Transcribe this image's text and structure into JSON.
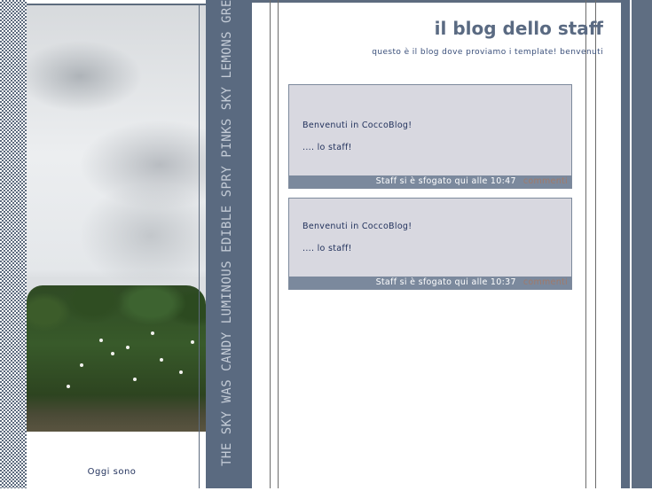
{
  "blog": {
    "title": "il blog dello staff",
    "subtitle": "questo è il blog dove proviamo i template! benvenuti"
  },
  "sidebar": {
    "caption": "Oggi sono",
    "band_text": "THE SKY WAS CANDY LUMINOUS EDIBLE SPRY PINKS SKY LEMONS GREENS COOL CHOCOLA"
  },
  "posts": [
    {
      "line1": "Benvenuti in CoccoBlog!",
      "line2": ".... lo staff!",
      "footer": "Staff si è sfogato qui alle 10:47",
      "comments": "commenti"
    },
    {
      "line1": "Benvenuti in CoccoBlog!",
      "line2": ".... lo staff!",
      "footer": "Staff si è sfogato qui alle 10:37",
      "comments": "commenti"
    }
  ],
  "colors": {
    "accent": "#5a6a80",
    "post_bg": "#d8d8e0",
    "footer_bg": "#7b899d",
    "text": "#1f2f5a"
  }
}
